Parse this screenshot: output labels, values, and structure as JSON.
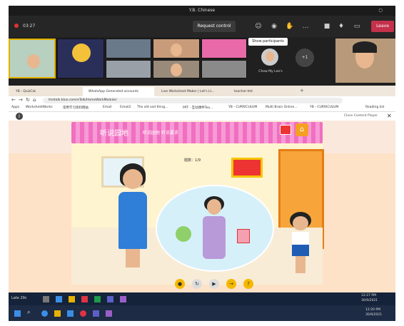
{
  "teams": {
    "window_title": "Y.B. Chinese",
    "timer": "03:27",
    "request_control": "Request control",
    "leave": "Leave",
    "tooltip": "Show participants",
    "participant_name": "Chew My Lee's",
    "overflow_count": "+1"
  },
  "browser": {
    "tabs": [
      "YB - QuizCat",
      "WhatsApp Generated accounts",
      "Live Worksheet Maker | Let's LI...",
      "teacher-lmt"
    ],
    "url": "lmstalk.blue.com/eTalk/HomeWorkModule/",
    "bookmarks": [
      "Apps",
      "WorksheetWorks",
      "常用学习资料网站",
      "Email",
      "Email2",
      "The old sad thing...",
      "PPT - 互动课件Tex...",
      "YB - CURRICULUM",
      "Multi Brain Online...",
      "YB - CURRICULUM",
      "Reading list"
    ],
    "close_content": "Close Content Player"
  },
  "game": {
    "title": "听说园地",
    "subtitle": "听说园地 听说要求",
    "question_label": "题数：1/9"
  },
  "taskbar": {
    "weather": "Late 29c",
    "time": "12:27 PM",
    "date": "30/9/2021",
    "time2": "12:20 PM",
    "date2": "30/9/2021"
  },
  "colors": {
    "banner": "#f06fc0",
    "leave": "#c4314b",
    "taskbar": "#15233a"
  }
}
